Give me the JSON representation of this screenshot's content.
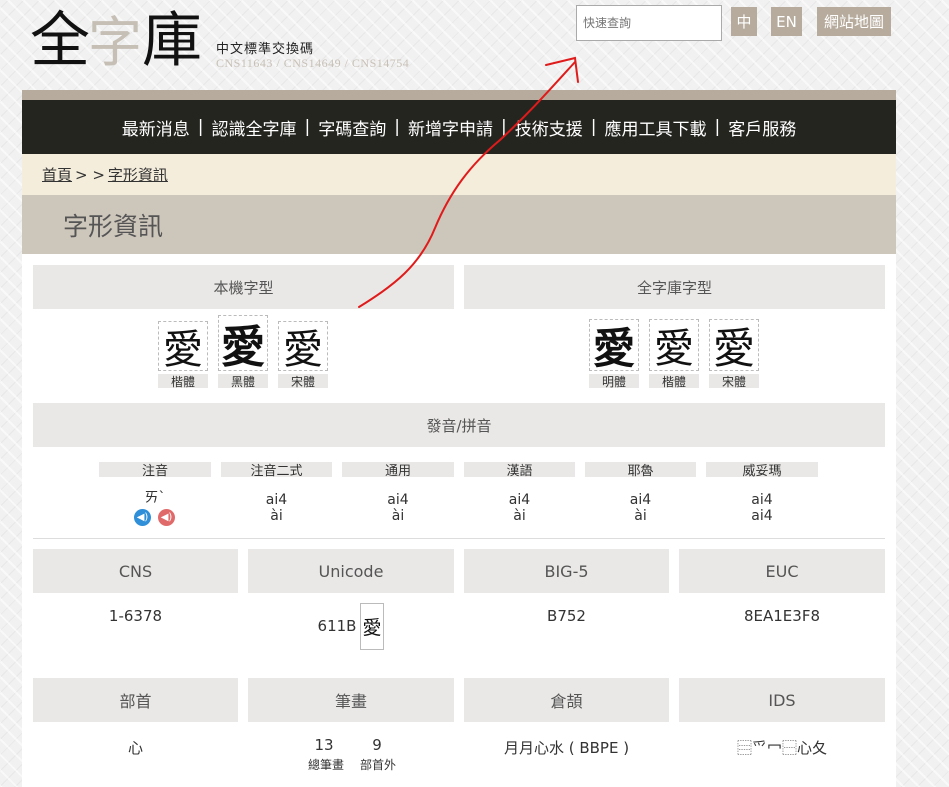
{
  "header": {
    "logo_chars": [
      "全",
      "字",
      "庫"
    ],
    "subtitle": "中文標準交換碼",
    "standards": "CNS11643 / CNS14649 / CNS14754",
    "search_placeholder": "快速查詢",
    "lang_zh": "中",
    "lang_en": "EN",
    "sitemap": "網站地圖"
  },
  "nav": {
    "items": [
      "最新消息",
      "認識全字庫",
      "字碼查詢",
      "新增字申請",
      "技術支援",
      "應用工具下載",
      "客戶服務"
    ],
    "separator": "|"
  },
  "breadcrumb": {
    "home": "首頁",
    "sep": "> >",
    "current": "字形資訊"
  },
  "page_title": "字形資訊",
  "glyphs": {
    "local_header": "本機字型",
    "cns_header": "全字庫字型",
    "character": "愛",
    "local_fonts": [
      "楷體",
      "黑體",
      "宋體"
    ],
    "cns_fonts": [
      "明體",
      "楷體",
      "宋體"
    ]
  },
  "pronunciation": {
    "header": "發音/拼音",
    "columns": [
      {
        "label": "注音",
        "value": "ㄞˋ",
        "value2": ""
      },
      {
        "label": "注音二式",
        "value": "ai4",
        "value2": "ài"
      },
      {
        "label": "通用",
        "value": "ai4",
        "value2": "ài"
      },
      {
        "label": "漢語",
        "value": "ai4",
        "value2": "ài"
      },
      {
        "label": "耶魯",
        "value": "ai4",
        "value2": "ài"
      },
      {
        "label": "威妥瑪",
        "value": "ai4",
        "value2": "ai4"
      }
    ]
  },
  "codes": [
    {
      "label": "CNS",
      "value": "1-6378"
    },
    {
      "label": "Unicode",
      "value": "611B"
    },
    {
      "label": "BIG-5",
      "value": "B752"
    },
    {
      "label": "EUC",
      "value": "8EA1E3F8"
    }
  ],
  "attributes": {
    "radical_label": "部首",
    "radical_value": "心",
    "strokes_label": "筆畫",
    "total_strokes": "13",
    "total_label": "總筆畫",
    "extra_strokes": "9",
    "extra_label": "部首外",
    "cangjie_label": "倉頡",
    "cangjie_value": "月月心水 ( BBPE )",
    "ids_label": "IDS",
    "ids_value": "⿳爫冖⿱心夂"
  },
  "colors": {
    "accent": "#b6ab9c",
    "nav_bg": "#252520",
    "crumb_bg": "#f4eddc",
    "title_bg": "#cdc6bb",
    "annotation": "#e01b1b"
  }
}
